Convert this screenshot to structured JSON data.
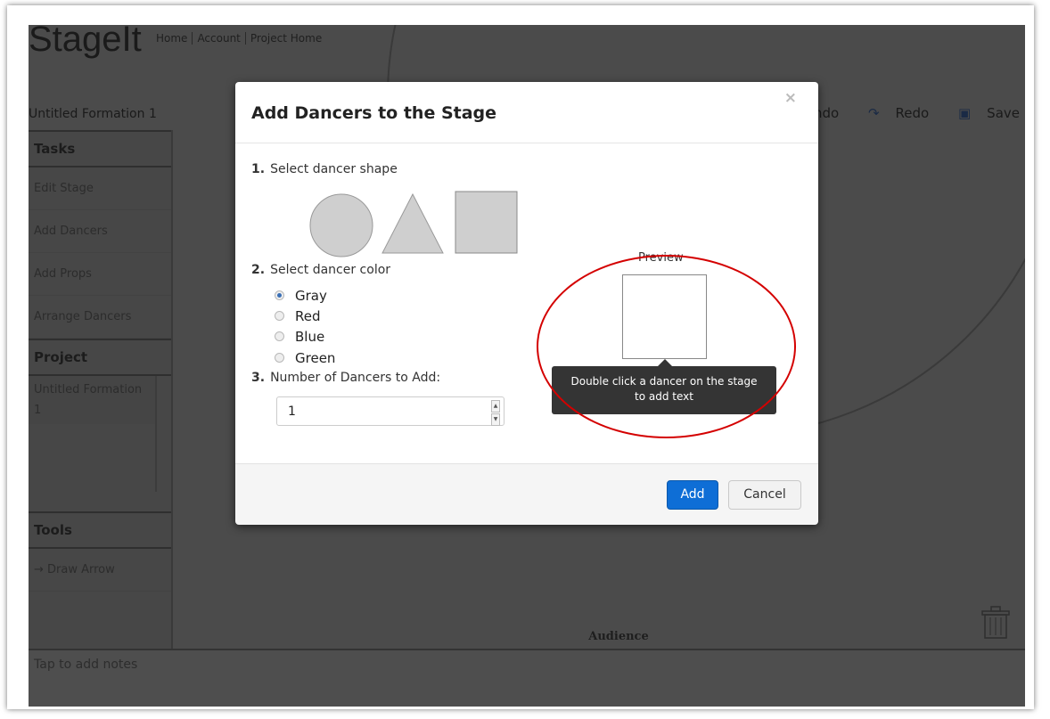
{
  "app": {
    "logo": "StageIt",
    "nav": [
      "Home",
      "Account",
      "Project Home"
    ],
    "formation_title": "Untitled Formation 1",
    "toolbar": {
      "undo": "Undo",
      "redo": "Redo",
      "save": "Save"
    }
  },
  "sidebar": {
    "tasks_heading": "Tasks",
    "tasks": [
      "Edit Stage",
      "Add Dancers",
      "Add Props",
      "Arrange Dancers"
    ],
    "project_heading": "Project",
    "project_item": "Untitled Formation 1",
    "tools_heading": "Tools",
    "tools": [
      "Draw Arrow"
    ]
  },
  "stage": {
    "audience_label": "Audience"
  },
  "notes": {
    "placeholder": "Tap to add notes"
  },
  "modal": {
    "title": "Add Dancers to the Stage",
    "close": "×",
    "step1": {
      "num": "1.",
      "label": "Select dancer shape"
    },
    "shapes": [
      "circle",
      "triangle",
      "square"
    ],
    "step2": {
      "num": "2.",
      "label": "Select dancer color"
    },
    "colors": [
      {
        "label": "Gray",
        "selected": true
      },
      {
        "label": "Red",
        "selected": false
      },
      {
        "label": "Blue",
        "selected": false
      },
      {
        "label": "Green",
        "selected": false
      }
    ],
    "step3": {
      "num": "3.",
      "label": "Number of Dancers to Add:"
    },
    "count_value": "1",
    "preview_label": "Preview",
    "tooltip_line1": "Double click a dancer on the stage",
    "tooltip_line2": "to add text",
    "add_button": "Add",
    "cancel_button": "Cancel"
  },
  "colors": {
    "accent": "#0e6ed6",
    "annotation_circle": "#d40000",
    "overlay_bg": "#4b4b4b"
  }
}
